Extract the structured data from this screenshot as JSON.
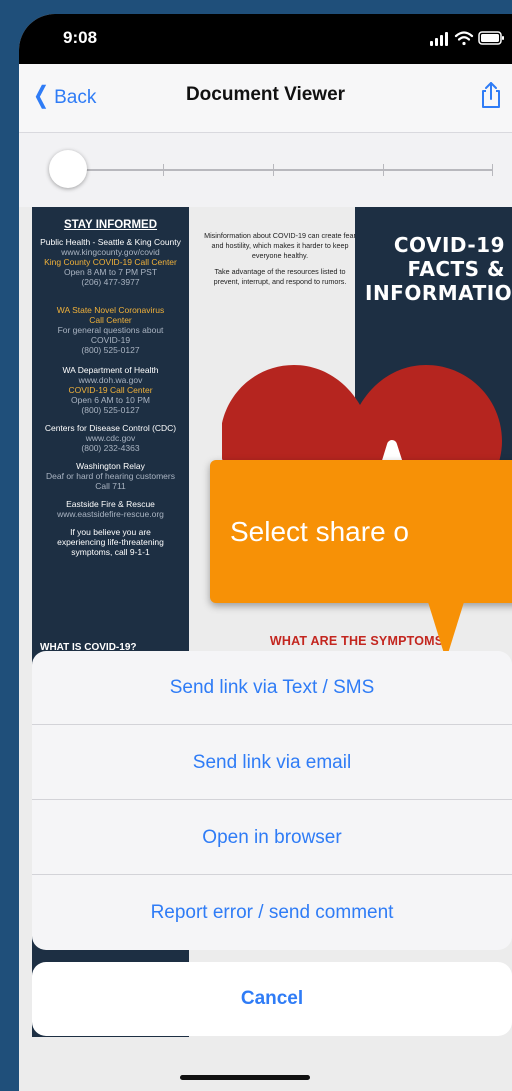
{
  "status_bar": {
    "time": "9:08"
  },
  "nav": {
    "back_label": "Back",
    "title": "Document Viewer"
  },
  "document": {
    "left_column": {
      "heading": "STAY INFORMED",
      "blocks": [
        {
          "lines": [
            "Public Health - Seattle & King County"
          ],
          "grey": [
            "www.kingcounty.gov/covid"
          ],
          "gold": [
            "King County COVID-19 Call Center"
          ],
          "grey2": [
            "Open 8 AM to 7 PM PST",
            "(206) 477-3977"
          ]
        },
        {
          "gold": [
            "WA State Novel Coronavirus",
            "Call Center"
          ],
          "grey": [
            "For general questions about",
            "COVID-19",
            "(800) 525-0127"
          ]
        },
        {
          "lines": [
            "WA Department of Health"
          ],
          "grey": [
            "www.doh.wa.gov"
          ],
          "gold": [
            "COVID-19 Call Center"
          ],
          "grey2": [
            "Open 6 AM to 10 PM",
            "(800) 525-0127"
          ]
        },
        {
          "lines": [
            "Centers for Disease Control (CDC)"
          ],
          "grey": [
            "www.cdc.gov",
            "(800) 232-4363"
          ]
        },
        {
          "lines": [
            "Washington Relay"
          ],
          "grey": [
            "Deaf or hard of hearing customers",
            "Call 711"
          ]
        },
        {
          "lines": [
            "Eastside Fire & Rescue"
          ],
          "grey": [
            "www.eastsidefire-rescue.org"
          ]
        },
        {
          "lines": [
            "If you believe you are",
            "experiencing life-threatening",
            "symptoms, call 9-1-1"
          ]
        }
      ]
    },
    "middle_text": [
      "Misinformation about COVID-19 can create fear and hostility, which makes it harder to keep everyone healthy.",
      "Take advantage of the resources listed to prevent, interrupt, and respond to rumors."
    ],
    "right_title": [
      "COVID-19",
      "FACTS &",
      "INFORMATION"
    ],
    "what_is_title": "WHAT IS COVID-19?",
    "symptoms_title": "WHAT ARE THE SYMPTOMS?"
  },
  "callout": {
    "text": "Select share o"
  },
  "action_sheet": {
    "items": [
      {
        "label": "Send link via Text / SMS"
      },
      {
        "label": "Send link via email"
      },
      {
        "label": "Open in browser"
      },
      {
        "label": "Report error / send comment"
      }
    ],
    "cancel_label": "Cancel"
  },
  "colors": {
    "accent": "#2f7cf6",
    "callout": "#f79106",
    "poster_navy": "#1d2f43",
    "poster_red": "#b5251f",
    "poster_gold": "#f0b13a"
  }
}
